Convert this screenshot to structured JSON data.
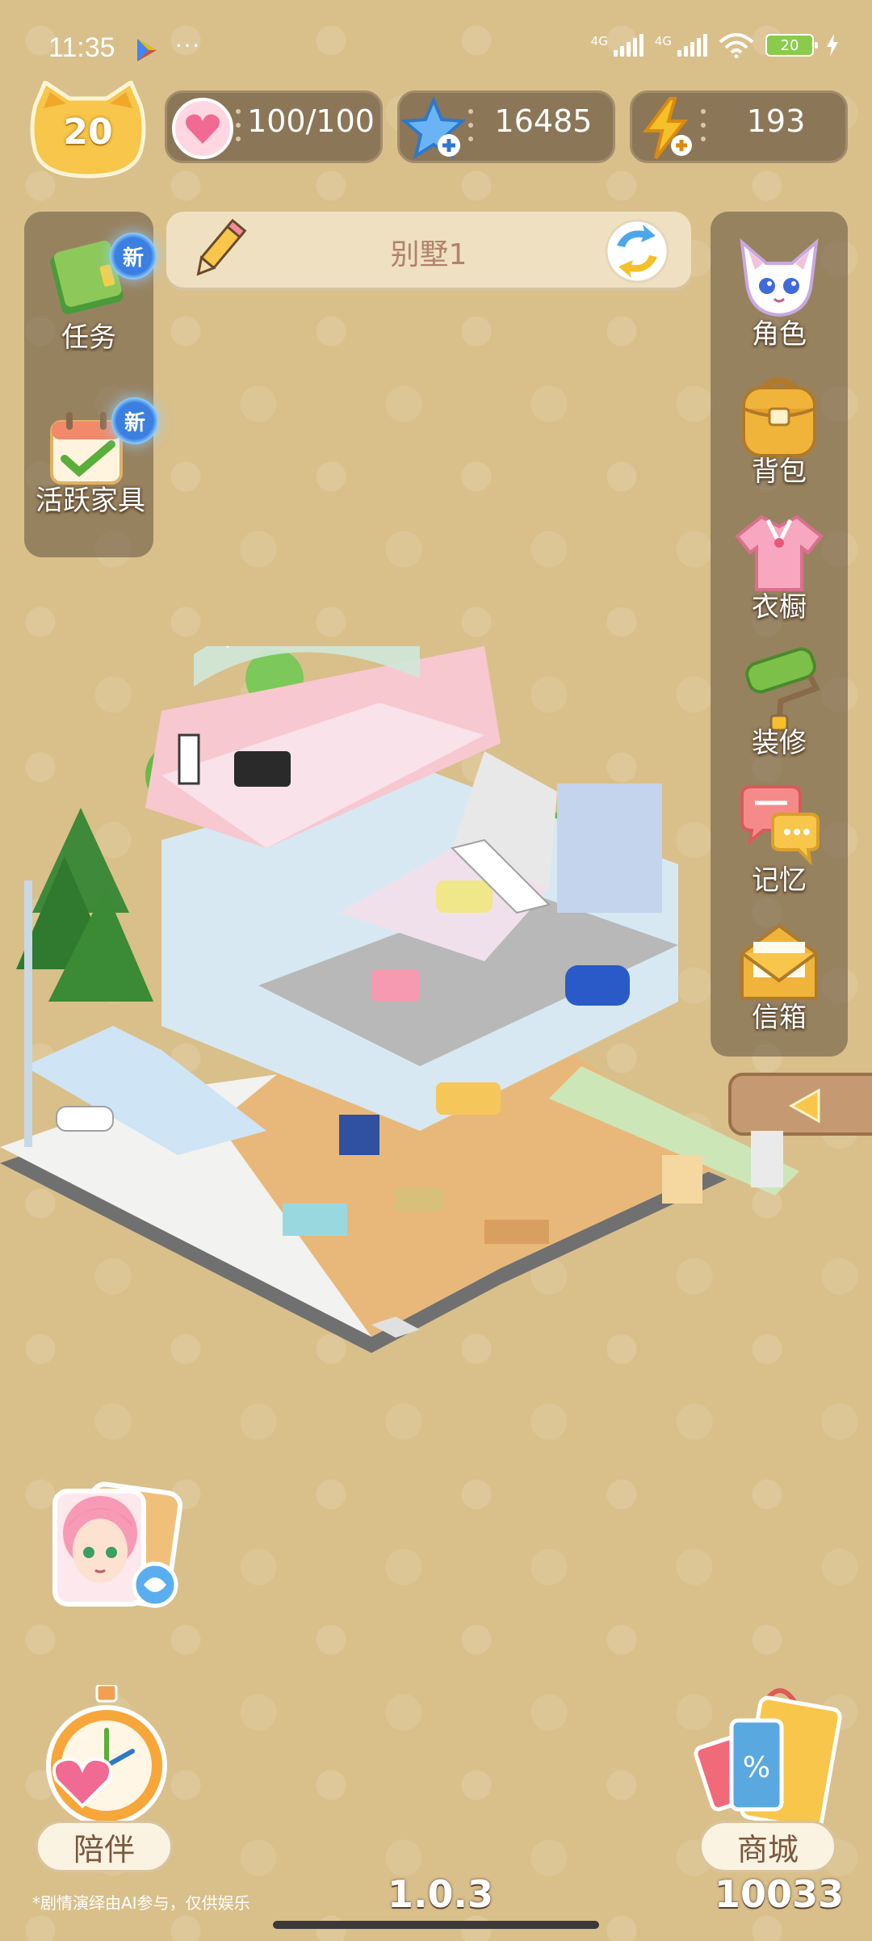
{
  "status_bar": {
    "time": "11:35",
    "more": "···",
    "signal_1": "4G",
    "signal_2": "4G",
    "battery": "20"
  },
  "player": {
    "level": "20"
  },
  "resources": {
    "hearts": "100/100",
    "stars": "16485",
    "energy": "193"
  },
  "left_menu": {
    "tasks_label": "任务",
    "tasks_badge": "新",
    "active_furniture_label": "活跃家具",
    "active_furniture_badge": "新"
  },
  "house": {
    "name": "别墅1"
  },
  "right_menu": {
    "character": "角色",
    "backpack": "背包",
    "wardrobe": "衣橱",
    "decorate": "装修",
    "memories": "记忆",
    "mailbox": "信箱"
  },
  "bottom": {
    "companion_label": "陪伴",
    "shop_label": "商城",
    "disclaimer": "*剧情演绎由AI参与，仅供娱乐",
    "version": "1.0.3",
    "user_id": "10033"
  },
  "colors": {
    "background": "#d9bf8a",
    "panel": "#60503e",
    "pill": "#8b7658",
    "accent_blue": "#3b7fe0",
    "heart_pink": "#f06a93",
    "energy_yellow": "#f5c02a"
  },
  "icons": {
    "level": "cat-head-badge",
    "hearts": "heart-icon",
    "stars": "star-plus-icon",
    "energy": "lightning-plus-icon",
    "edit": "pencil-icon",
    "switch": "swap-icon",
    "collapse": "triangle-left-icon"
  }
}
